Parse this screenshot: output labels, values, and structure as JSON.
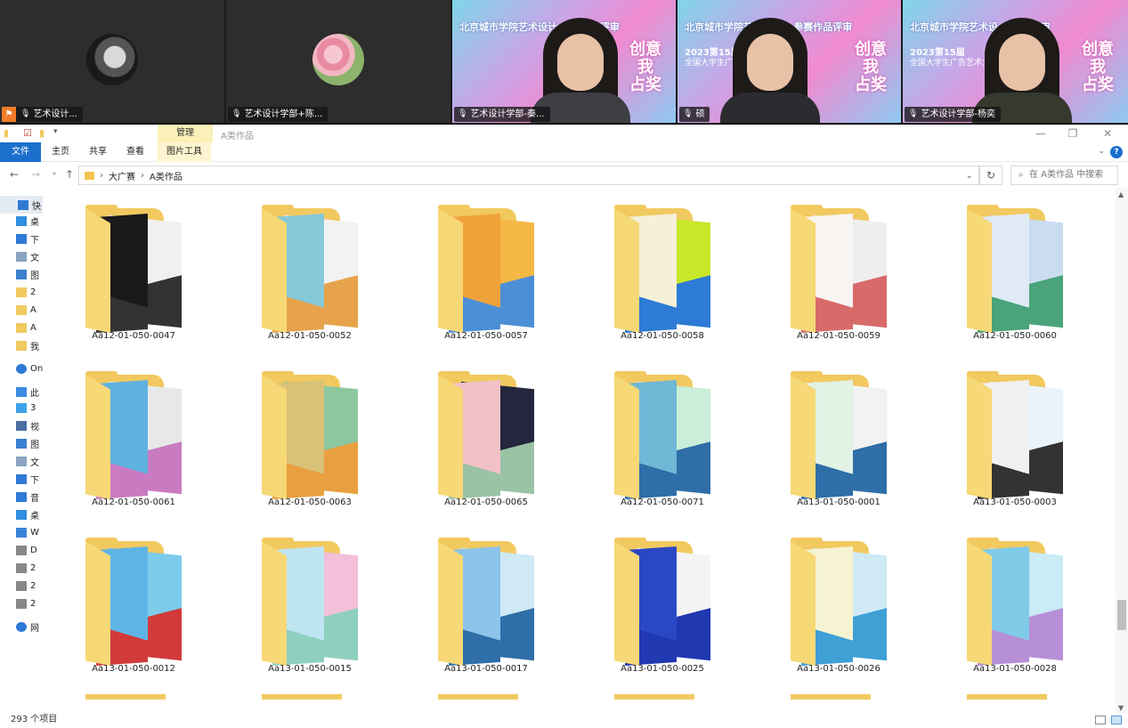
{
  "meeting": {
    "participants": [
      {
        "name": "艺术设计...",
        "kind": "avatar",
        "host": true
      },
      {
        "name": "艺术设计学部+陈...",
        "kind": "avatar"
      },
      {
        "name": "艺术设计学部-秦...",
        "kind": "video"
      },
      {
        "name": "硕",
        "kind": "video"
      },
      {
        "name": "艺术设计学部-杨奕",
        "kind": "video"
      }
    ],
    "banner": {
      "line1a": "北京城市学院艺术设计",
      "line1a_end": "赛作品评审",
      "line1b": "北京城市学院艺术设计",
      "line1b_end": "- 参赛作品评审",
      "line1c": "北京城市学院艺术设",
      "line1c_end": "作品评审",
      "line2": "2023第15届",
      "line3": "全国大学生广告艺术大",
      "brand1": "创意我",
      "brand2": "占奖"
    }
  },
  "explorer": {
    "title": "A类作品",
    "context_group": "管理",
    "ribbon_tabs": [
      "文件",
      "主页",
      "共享",
      "查看",
      "图片工具"
    ],
    "breadcrumb": [
      "大广赛",
      "A类作品"
    ],
    "search_placeholder": "在 A类作品 中搜索",
    "status": "293 个项目",
    "nav": [
      {
        "label": "快",
        "icon": "star-icon",
        "color": "#2f7ad6"
      },
      {
        "label": "桌",
        "icon": "desktop-icon",
        "color": "#2f8fe0"
      },
      {
        "label": "下",
        "icon": "download-icon",
        "color": "#2f7ad6"
      },
      {
        "label": "文",
        "icon": "document-icon",
        "color": "#8aa4c2"
      },
      {
        "label": "图",
        "icon": "picture-icon",
        "color": "#3b7fcf"
      },
      {
        "label": "2",
        "icon": "folder-icon",
        "color": "#f1c95f"
      },
      {
        "label": "A",
        "icon": "folder-icon",
        "color": "#f1c95f"
      },
      {
        "label": "A",
        "icon": "folder-icon",
        "color": "#f1c95f"
      },
      {
        "label": "我",
        "icon": "folder-icon",
        "color": "#f1c95f"
      },
      {
        "label": "On",
        "icon": "cloud-icon",
        "color": "#2f7ad6"
      },
      {
        "label": "此",
        "icon": "computer-icon",
        "color": "#3b8be0"
      },
      {
        "label": "3",
        "icon": "cube-icon",
        "color": "#3fa2e8"
      },
      {
        "label": "视",
        "icon": "video-icon",
        "color": "#4a6fa0"
      },
      {
        "label": "图",
        "icon": "picture-icon",
        "color": "#3b7fcf"
      },
      {
        "label": "文",
        "icon": "document-icon",
        "color": "#8aa4c2"
      },
      {
        "label": "下",
        "icon": "download-icon",
        "color": "#2f7ad6"
      },
      {
        "label": "音",
        "icon": "music-icon",
        "color": "#2f7ad6"
      },
      {
        "label": "桌",
        "icon": "desktop-icon",
        "color": "#2f8fe0"
      },
      {
        "label": "W",
        "icon": "drive-icon",
        "color": "#3a84d8"
      },
      {
        "label": "D",
        "icon": "drive-icon",
        "color": "#888"
      },
      {
        "label": "2",
        "icon": "drive-icon",
        "color": "#888"
      },
      {
        "label": "2",
        "icon": "drive-icon",
        "color": "#888"
      },
      {
        "label": "2",
        "icon": "drive-icon",
        "color": "#888"
      },
      {
        "label": "网",
        "icon": "network-icon",
        "color": "#2f7ad6"
      }
    ],
    "folders": [
      {
        "name": "Aa12-01-050-0047",
        "c1": "#1a1a1a",
        "c2": "#f0f0f0",
        "c3": "#333"
      },
      {
        "name": "Aa12-01-050-0052",
        "c1": "#86c9d9",
        "c2": "#f2f2f2",
        "c3": "#e6a34b"
      },
      {
        "name": "Aa12-01-050-0057",
        "c1": "#f0a23a",
        "c2": "#f5b845",
        "c3": "#4c8fd6"
      },
      {
        "name": "Aa12-01-050-0058",
        "c1": "#f5f0d8",
        "c2": "#c8e62a",
        "c3": "#2d7bd6"
      },
      {
        "name": "Aa12-01-050-0059",
        "c1": "#f7f4f2",
        "c2": "#eeeeee",
        "c3": "#d96a6a"
      },
      {
        "name": "Aa12-01-050-0060",
        "c1": "#dfeaf5",
        "c2": "#c9dcf0",
        "c3": "#4aa37a"
      },
      {
        "name": "Aa12-01-050-0061",
        "c1": "#5fb2df",
        "c2": "#e8e8e8",
        "c3": "#c97bc2"
      },
      {
        "name": "Aa12-01-050-0063",
        "c1": "#d9c277",
        "c2": "#8cc7a0",
        "c3": "#e9a040"
      },
      {
        "name": "Aa12-01-050-0065",
        "c1": "#f2c1c7",
        "c2": "#23263d",
        "c3": "#9ac2a5"
      },
      {
        "name": "Aa12-01-050-0071",
        "c1": "#6fb8d6",
        "c2": "#c9eed9",
        "c3": "#2f6ea8"
      },
      {
        "name": "Aa13-01-050-0001",
        "c1": "#e2f2e5",
        "c2": "#f2f2f2",
        "c3": "#2f6ea8"
      },
      {
        "name": "Aa13-01-050-0003",
        "c1": "#f0f0f0",
        "c2": "#e9f3f9",
        "c3": "#333"
      },
      {
        "name": "Aa13-01-050-0012",
        "c1": "#5fb4e6",
        "c2": "#7ccbea",
        "c3": "#d23a3a"
      },
      {
        "name": "Aa13-01-050-0015",
        "c1": "#bfe4f2",
        "c2": "#f2c0d8",
        "c3": "#8ed0c0"
      },
      {
        "name": "Aa13-01-050-0017",
        "c1": "#8cc4ea",
        "c2": "#cfe9f5",
        "c3": "#2f6ea8"
      },
      {
        "name": "Aa13-01-050-0025",
        "c1": "#2b48c4",
        "c2": "#f4f4f4",
        "c3": "#2038b0"
      },
      {
        "name": "Aa13-01-050-0026",
        "c1": "#f6f3d2",
        "c2": "#cfeaf5",
        "c3": "#3fa0d6"
      },
      {
        "name": "Aa13-01-050-0028",
        "c1": "#7fcbe8",
        "c2": "#c9ecf6",
        "c3": "#b78fd6"
      }
    ]
  }
}
